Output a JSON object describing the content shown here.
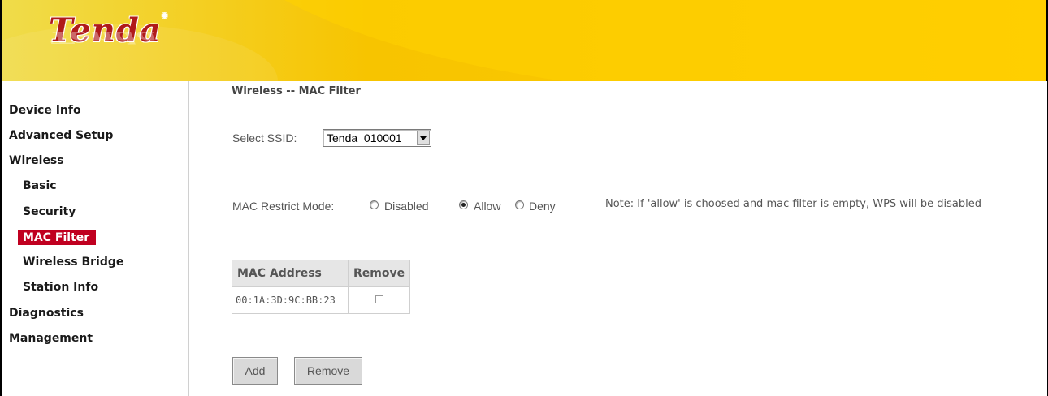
{
  "brand": {
    "logo_text": "Tenda"
  },
  "sidebar": {
    "items": [
      {
        "label": "Device Info"
      },
      {
        "label": "Advanced Setup"
      },
      {
        "label": "Wireless"
      },
      {
        "label": "Basic"
      },
      {
        "label": "Security"
      },
      {
        "label": "MAC Filter"
      },
      {
        "label": "Wireless Bridge"
      },
      {
        "label": "Station Info"
      },
      {
        "label": "Diagnostics"
      },
      {
        "label": "Management"
      }
    ],
    "active_item": "MAC Filter",
    "active_color": "#c00020"
  },
  "main": {
    "title": "Wireless -- MAC Filter",
    "ssid": {
      "label": "Select SSID:",
      "selected": "Tenda_010001"
    },
    "restrict_mode": {
      "label": "MAC Restrict Mode:",
      "options": [
        {
          "label": "Disabled",
          "checked": false
        },
        {
          "label": "Allow",
          "checked": true
        },
        {
          "label": "Deny",
          "checked": false
        }
      ],
      "note": "Note: If 'allow' is choosed and mac filter is empty, WPS will be disabled"
    },
    "table": {
      "headers": [
        "MAC Address",
        "Remove"
      ],
      "rows": [
        {
          "mac": "00:1A:3D:9C:BB:23",
          "remove_checked": false
        }
      ]
    },
    "buttons": {
      "add": "Add",
      "remove": "Remove"
    }
  },
  "colors": {
    "header_bg": "#ffcc00",
    "logo": "#b01a1a"
  }
}
